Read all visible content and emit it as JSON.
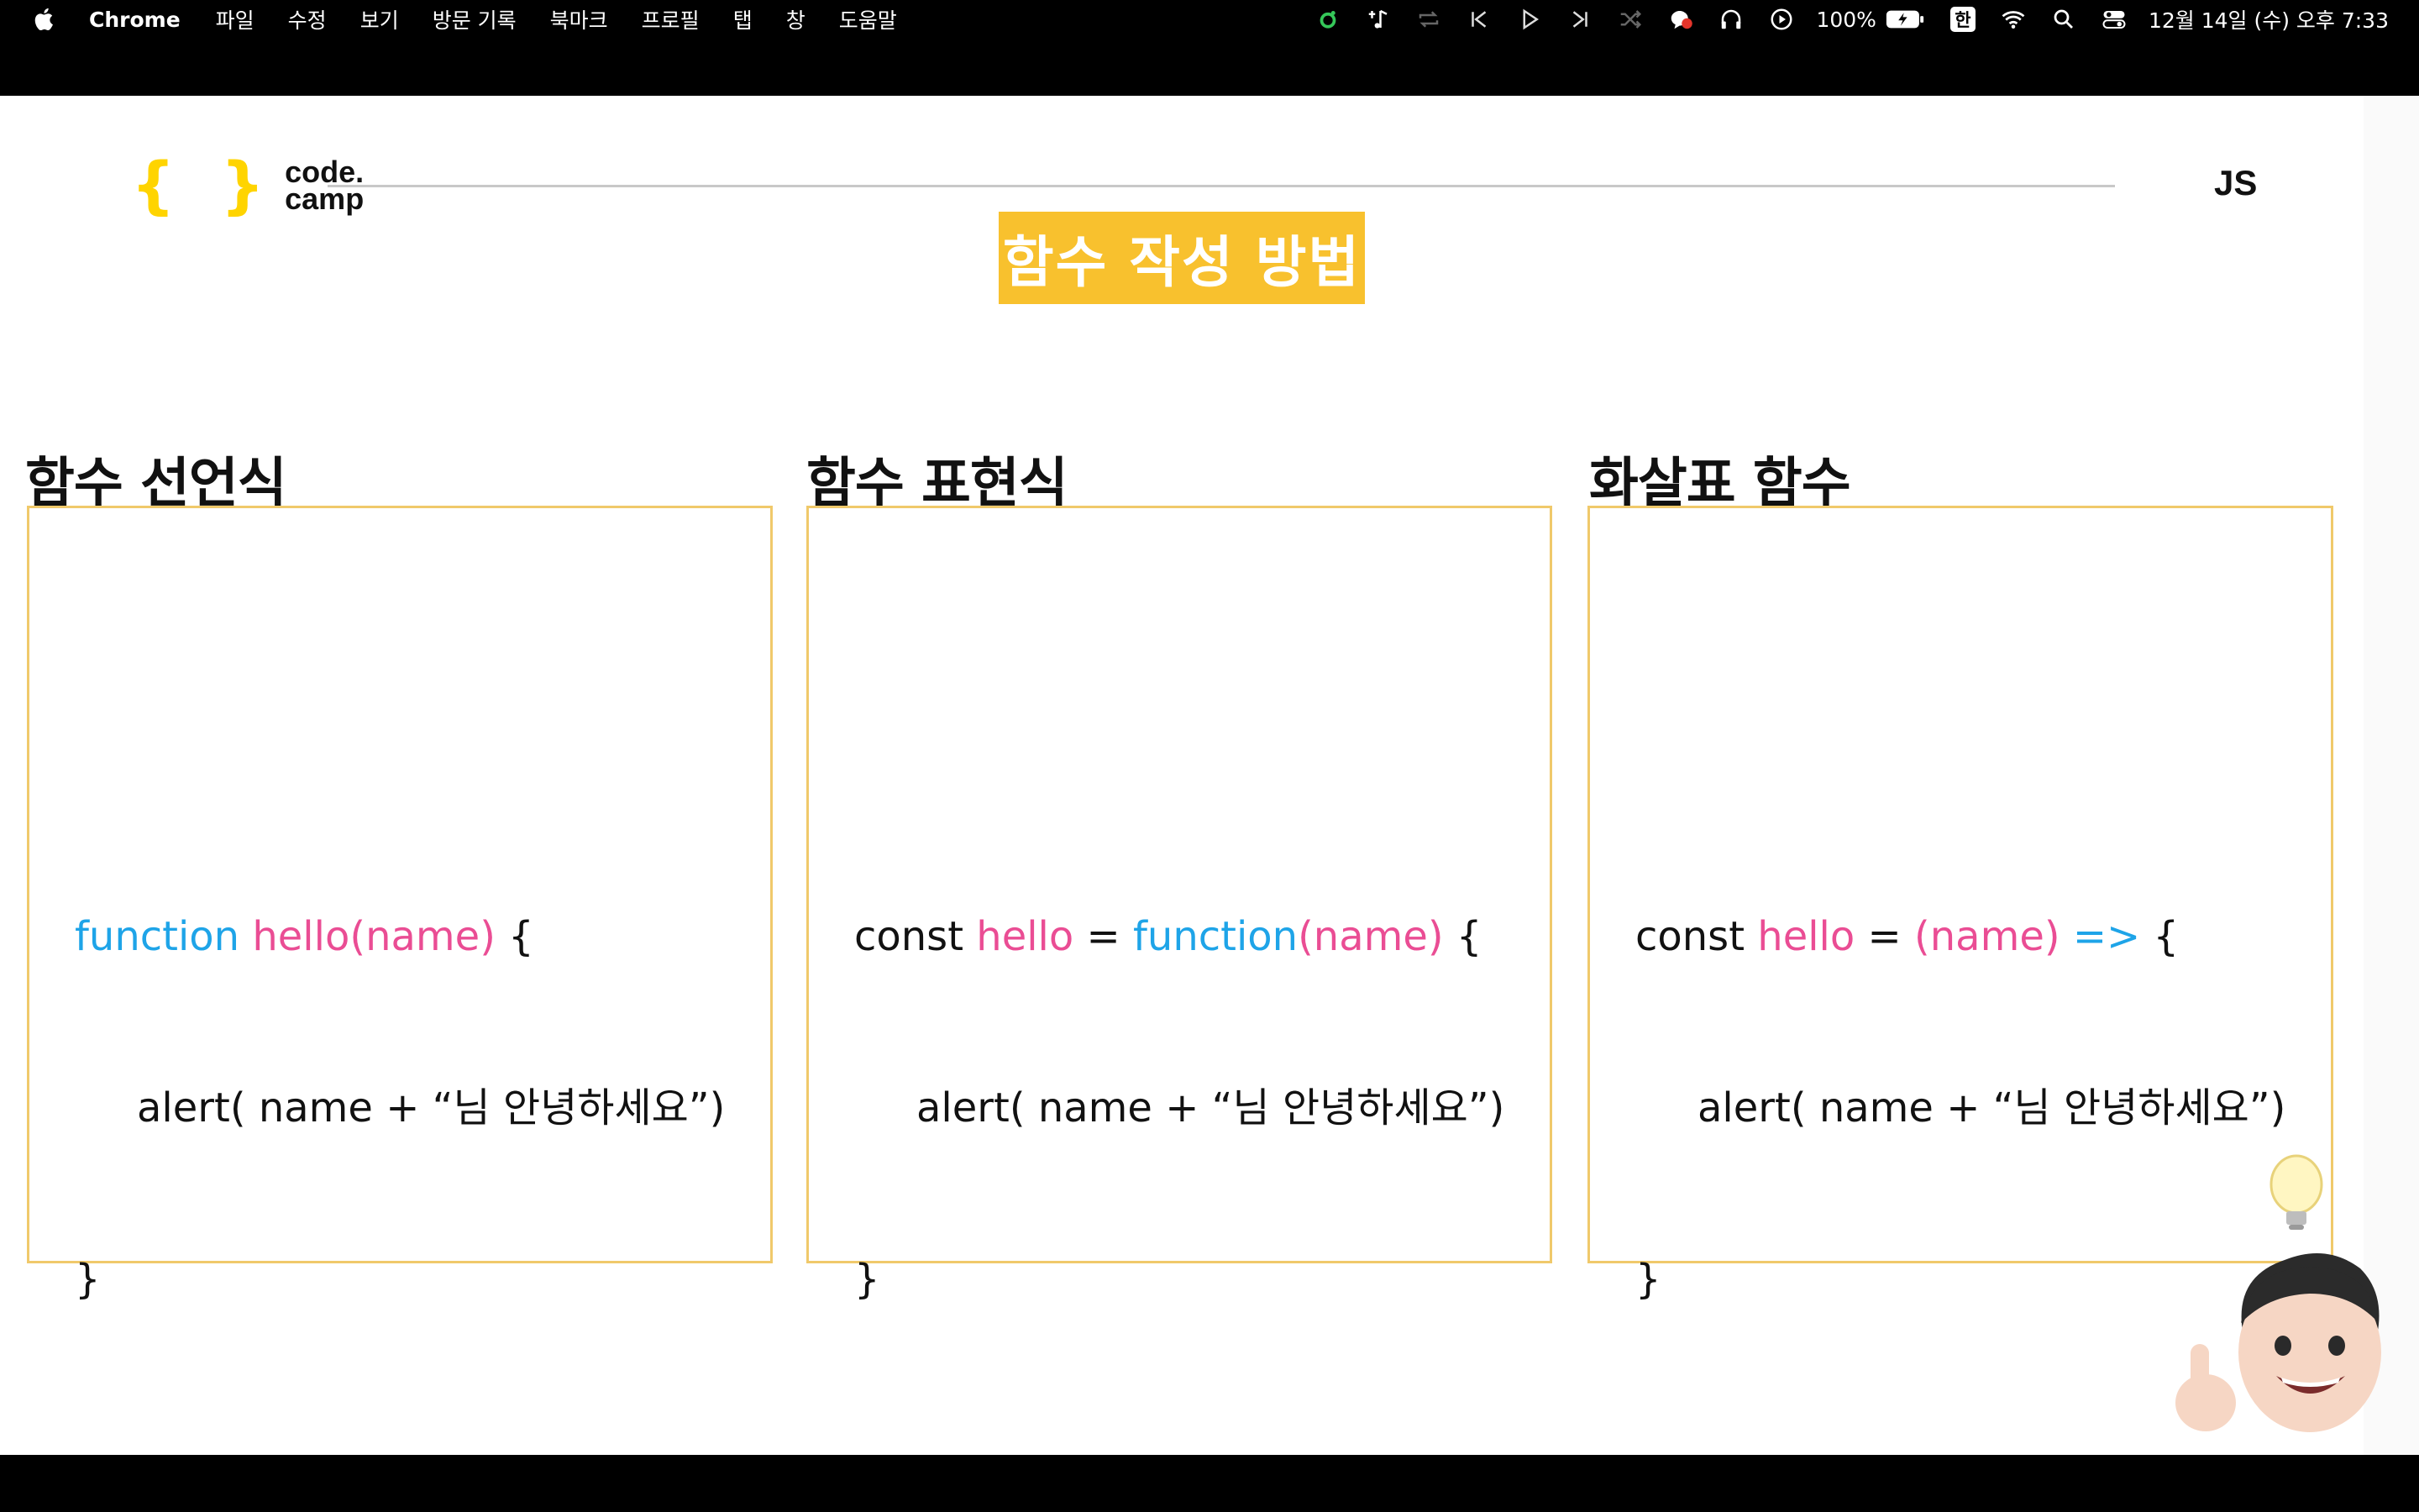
{
  "menubar": {
    "app": "Chrome",
    "menus": [
      "파일",
      "수정",
      "보기",
      "방문 기록",
      "북마크",
      "프로필",
      "탭",
      "창",
      "도움말"
    ],
    "battery": "100%",
    "input_method": "한",
    "datetime": "12월 14일 (수) 오후 7:33"
  },
  "slide": {
    "logo_braces": "{ }",
    "logo_line1": "code.",
    "logo_line2": "camp",
    "lang": "JS",
    "title": "함수 작성 방법",
    "columns": [
      {
        "title": "함수 선언식",
        "line1": [
          {
            "text": "function ",
            "color": "blue"
          },
          {
            "text": "hello(name)",
            "color": "pink"
          },
          {
            "text": " {",
            "color": "plain"
          }
        ],
        "line2": "alert( name + “님 안녕하세요”)",
        "line3": "}"
      },
      {
        "title": "함수 표현식",
        "line1": [
          {
            "text": "const ",
            "color": "plain"
          },
          {
            "text": "hello",
            "color": "pink"
          },
          {
            "text": " = ",
            "color": "plain"
          },
          {
            "text": "function",
            "color": "blue"
          },
          {
            "text": "(name)",
            "color": "pink"
          },
          {
            "text": " {",
            "color": "plain"
          }
        ],
        "line2": "alert( name + “님 안녕하세요”)",
        "line3": "}"
      },
      {
        "title": "화살표 함수",
        "line1": [
          {
            "text": "const ",
            "color": "plain"
          },
          {
            "text": "hello",
            "color": "pink"
          },
          {
            "text": " = ",
            "color": "plain"
          },
          {
            "text": "(name)",
            "color": "pink"
          },
          {
            "text": " =>",
            "color": "blue"
          },
          {
            "text": " {",
            "color": "plain"
          }
        ],
        "line2": "alert( name + “님 안녕하세요”)",
        "line3": "}"
      }
    ]
  },
  "colors": {
    "accent": "#f8c12e",
    "keyword": "#1ea4e8",
    "identifier": "#ea4d94",
    "box_border": "#f0c96b"
  },
  "icons": [
    "apple-icon",
    "status-dot-icon",
    "music-icon",
    "repeat-icon",
    "previous-icon",
    "play-icon",
    "next-icon",
    "shuffle-icon",
    "chat-icon",
    "headphones-icon",
    "play-circle-icon",
    "battery-icon",
    "wifi-icon",
    "search-icon",
    "control-center-icon",
    "lightbulb-icon",
    "memoji-avatar"
  ]
}
